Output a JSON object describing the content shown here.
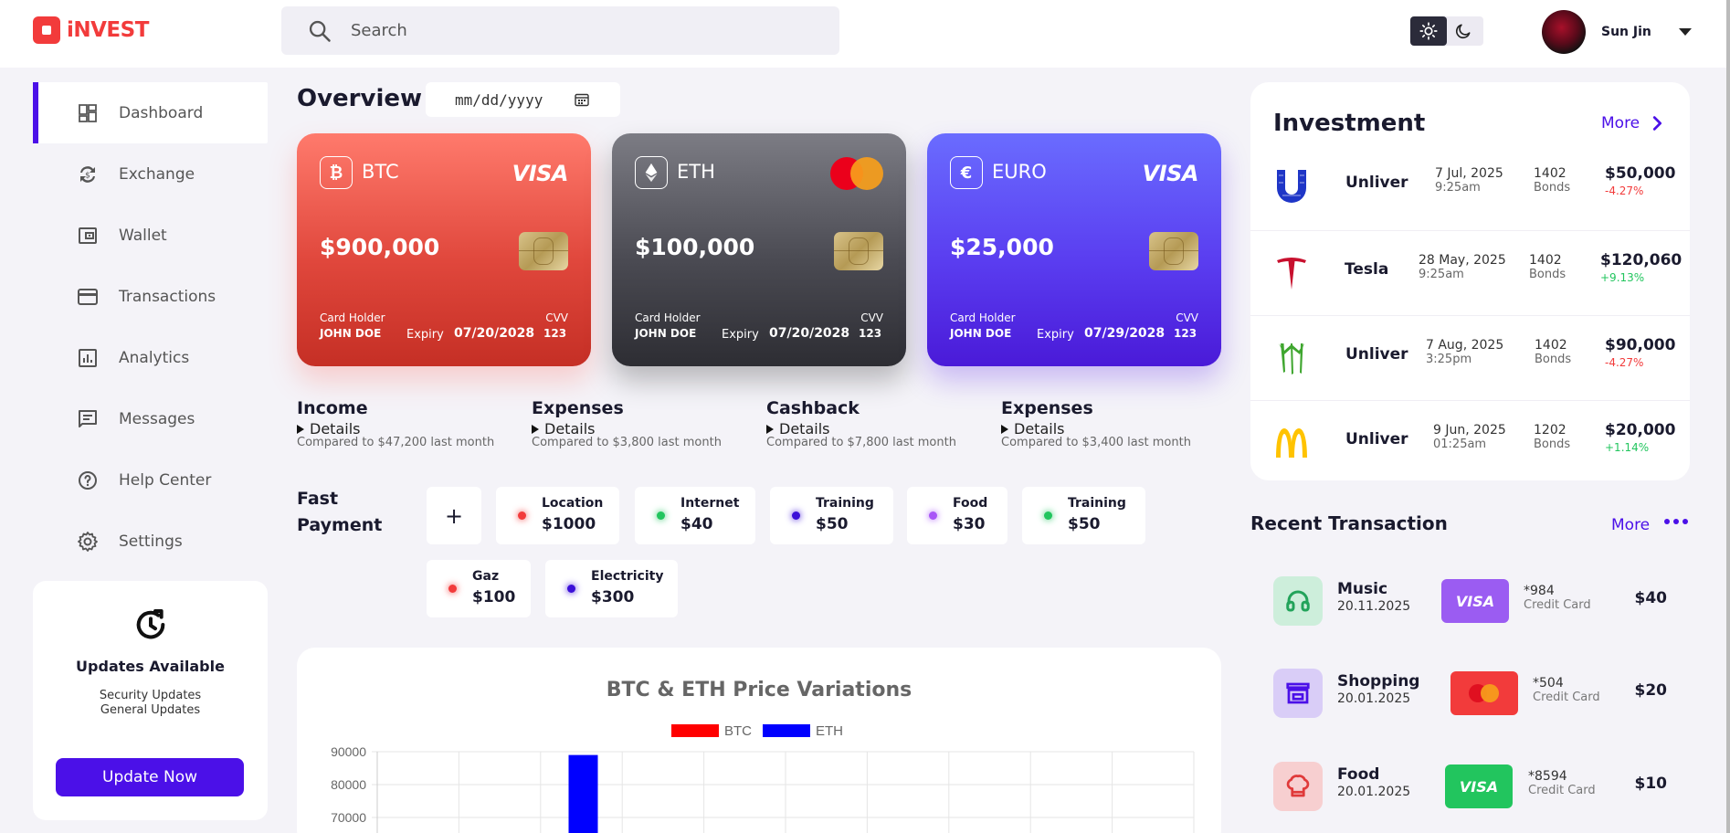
{
  "brand": {
    "logo": "iNVEST"
  },
  "search": {
    "placeholder": "Search"
  },
  "user": {
    "name": "Sun Jin"
  },
  "sidebar": {
    "items": [
      {
        "label": "Dashboard",
        "icon": "dashboard-icon"
      },
      {
        "label": "Exchange",
        "icon": "exchange-icon"
      },
      {
        "label": "Wallet",
        "icon": "wallet-icon"
      },
      {
        "label": "Transactions",
        "icon": "credit-card-icon"
      },
      {
        "label": "Analytics",
        "icon": "analytics-icon"
      },
      {
        "label": "Messages",
        "icon": "message-icon"
      },
      {
        "label": "Help Center",
        "icon": "help-icon"
      },
      {
        "label": "Settings",
        "icon": "gear-icon"
      }
    ]
  },
  "update": {
    "title": "Updates Available",
    "line1": "Security Updates",
    "line2": "General Updates",
    "button": "Update Now"
  },
  "overview": {
    "title": "Overview",
    "date_placeholder": "mm/dd/yyyy"
  },
  "cards": [
    {
      "name": "BTC",
      "brand": "VISA",
      "amount": "$900,000",
      "holder_label": "Card Holder",
      "holder": "JOHN DOE",
      "expiry_label": "Expiry",
      "expiry": "07/20/2028",
      "cvv_label": "CVV",
      "cvv": "123"
    },
    {
      "name": "ETH",
      "brand": "mastercard",
      "amount": "$100,000",
      "holder_label": "Card Holder",
      "holder": "JOHN DOE",
      "expiry_label": "Expiry",
      "expiry": "07/20/2028",
      "cvv_label": "CVV",
      "cvv": "123"
    },
    {
      "name": "EURO",
      "brand": "VISA",
      "amount": "$25,000",
      "holder_label": "Card Holder",
      "holder": "JOHN DOE",
      "expiry_label": "Expiry",
      "expiry": "07/29/2028",
      "cvv_label": "CVV",
      "cvv": "123"
    }
  ],
  "stats": [
    {
      "title": "Income",
      "details": "Details",
      "compare": "Compared to $47,200 last month"
    },
    {
      "title": "Expenses",
      "details": "Details",
      "compare": "Compared to $3,800 last month"
    },
    {
      "title": "Cashback",
      "details": "Details",
      "compare": "Compared to $7,800 last month"
    },
    {
      "title": "Expenses",
      "details": "Details",
      "compare": "Compared to $3,400 last month"
    }
  ],
  "fast_payment": {
    "title_line1": "Fast",
    "title_line2": "Payment",
    "add": "+",
    "items": [
      {
        "label": "Location",
        "value": "$1000",
        "color": "#f23b3b"
      },
      {
        "label": "Internet",
        "value": "$40",
        "color": "#22c55e"
      },
      {
        "label": "Training",
        "value": "$50",
        "color": "#3b10d8"
      },
      {
        "label": "Food",
        "value": "$30",
        "color": "#a855f7"
      },
      {
        "label": "Training",
        "value": "$50",
        "color": "#22c55e"
      },
      {
        "label": "Gaz",
        "value": "$100",
        "color": "#f23b3b"
      },
      {
        "label": "Electricity",
        "value": "$300",
        "color": "#3b10d8"
      }
    ]
  },
  "chart_data": {
    "type": "bar",
    "title": "BTC & ETH Price Variations",
    "series": [
      {
        "name": "BTC",
        "color": "#ff0000"
      },
      {
        "name": "ETH",
        "color": "#0000ff"
      }
    ],
    "yticks": [
      90000,
      80000,
      70000
    ],
    "visible_ymin": 70000,
    "visible_ymax": 90000,
    "bars": [
      {
        "series": "ETH",
        "category_index": 2,
        "value": 89000
      }
    ],
    "category_count": 10
  },
  "investment": {
    "title": "Investment",
    "more": "More",
    "rows": [
      {
        "company": "Unliver",
        "date": "7 Jul, 2025",
        "time": "9:25am",
        "qty": "1402",
        "unit": "Bonds",
        "amount": "$50,000",
        "change": "-4.27%",
        "icon": "unilever-logo-icon"
      },
      {
        "company": "Tesla",
        "date": "28 May, 2025",
        "time": "9:25am",
        "qty": "1402",
        "unit": "Bonds",
        "amount": "$120,060",
        "change": "+9.13%",
        "icon": "tesla-logo-icon"
      },
      {
        "company": "Unliver",
        "date": "7 Aug, 2025",
        "time": "3:25pm",
        "qty": "1402",
        "unit": "Bonds",
        "amount": "$90,000",
        "change": "-4.27%",
        "icon": "monster-logo-icon"
      },
      {
        "company": "Unliver",
        "date": "9 Jun, 2025",
        "time": "01:25am",
        "qty": "1202",
        "unit": "Bonds",
        "amount": "$20,000",
        "change": "+1.14%",
        "icon": "mcdonalds-logo-icon"
      }
    ]
  },
  "recent": {
    "title": "Recent Transaction",
    "more": "More",
    "rows": [
      {
        "name": "Music",
        "date": "20.11.2025",
        "card_brand": "VISA",
        "card_num": "*984",
        "card_label": "Credit Card",
        "amount": "$40",
        "icon": "headphones-icon"
      },
      {
        "name": "Shopping",
        "date": "20.01.2025",
        "card_brand": "mastercard",
        "card_num": "*504",
        "card_label": "Credit Card",
        "amount": "$20",
        "icon": "store-icon"
      },
      {
        "name": "Food",
        "date": "20.01.2025",
        "card_brand": "VISA",
        "card_num": "*8594",
        "card_label": "Credit Card",
        "amount": "$10",
        "icon": "chef-hat-icon"
      }
    ]
  }
}
